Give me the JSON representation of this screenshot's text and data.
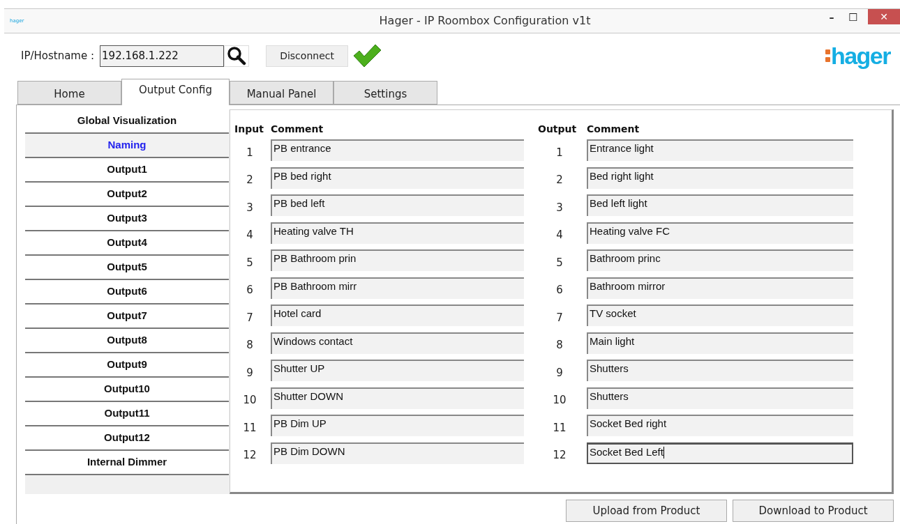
{
  "window": {
    "app_icon_text": "hager",
    "title": "Hager - IP Roombox Configuration v1t",
    "controls": [
      "–",
      "☐",
      "✕"
    ]
  },
  "connection": {
    "label": "IP/Hostname :",
    "host": "192.168.1.222",
    "disconnect": "Disconnect",
    "connected": true
  },
  "logo": "hager",
  "tabs": [
    {
      "label": "Home",
      "selected": false
    },
    {
      "label": "Output Config",
      "selected": true
    },
    {
      "label": "Manual Panel",
      "selected": false
    },
    {
      "label": "Settings",
      "selected": false
    }
  ],
  "sidebar": {
    "items": [
      {
        "label": "Global Visualization",
        "selected": false
      },
      {
        "label": "Naming",
        "selected": true
      },
      {
        "label": "Output1",
        "selected": false
      },
      {
        "label": "Output2",
        "selected": false
      },
      {
        "label": "Output3",
        "selected": false
      },
      {
        "label": "Output4",
        "selected": false
      },
      {
        "label": "Output5",
        "selected": false
      },
      {
        "label": "Output6",
        "selected": false
      },
      {
        "label": "Output7",
        "selected": false
      },
      {
        "label": "Output8",
        "selected": false
      },
      {
        "label": "Output9",
        "selected": false
      },
      {
        "label": "Output10",
        "selected": false
      },
      {
        "label": "Output11",
        "selected": false
      },
      {
        "label": "Output12",
        "selected": false
      },
      {
        "label": "Internal Dimmer",
        "selected": false
      }
    ]
  },
  "inputs": {
    "columns": [
      "Input",
      "Comment"
    ],
    "rows": [
      {
        "number": "1",
        "comment": "PB entrance"
      },
      {
        "number": "2",
        "comment": "PB bed right"
      },
      {
        "number": "3",
        "comment": "PB bed left"
      },
      {
        "number": "4",
        "comment": "Heating valve TH"
      },
      {
        "number": "5",
        "comment": "PB Bathroom prin"
      },
      {
        "number": "6",
        "comment": "PB Bathroom mirr"
      },
      {
        "number": "7",
        "comment": "Hotel card"
      },
      {
        "number": "8",
        "comment": "Windows contact"
      },
      {
        "number": "9",
        "comment": "Shutter UP"
      },
      {
        "number": "10",
        "comment": "Shutter DOWN"
      },
      {
        "number": "11",
        "comment": "PB Dim UP"
      },
      {
        "number": "12",
        "comment": "PB Dim DOWN"
      }
    ]
  },
  "outputs": {
    "columns": [
      "Output",
      "Comment"
    ],
    "rows": [
      {
        "number": "1",
        "comment": "Entrance light",
        "focused": false
      },
      {
        "number": "2",
        "comment": "Bed right light",
        "focused": false
      },
      {
        "number": "3",
        "comment": "Bed left light",
        "focused": false
      },
      {
        "number": "4",
        "comment": "Heating valve FC",
        "focused": false
      },
      {
        "number": "5",
        "comment": "Bathroom princ",
        "focused": false
      },
      {
        "number": "6",
        "comment": "Bathroom mirror",
        "focused": false
      },
      {
        "number": "7",
        "comment": "TV socket",
        "focused": false
      },
      {
        "number": "8",
        "comment": "Main light",
        "focused": false
      },
      {
        "number": "9",
        "comment": "Shutters",
        "focused": false
      },
      {
        "number": "10",
        "comment": "Shutters",
        "focused": false
      },
      {
        "number": "11",
        "comment": "Socket Bed right",
        "focused": false
      },
      {
        "number": "12",
        "comment": "Socket Bed Left",
        "focused": true
      }
    ]
  },
  "buttons": [
    "Upload from Product",
    "Download to Product"
  ]
}
